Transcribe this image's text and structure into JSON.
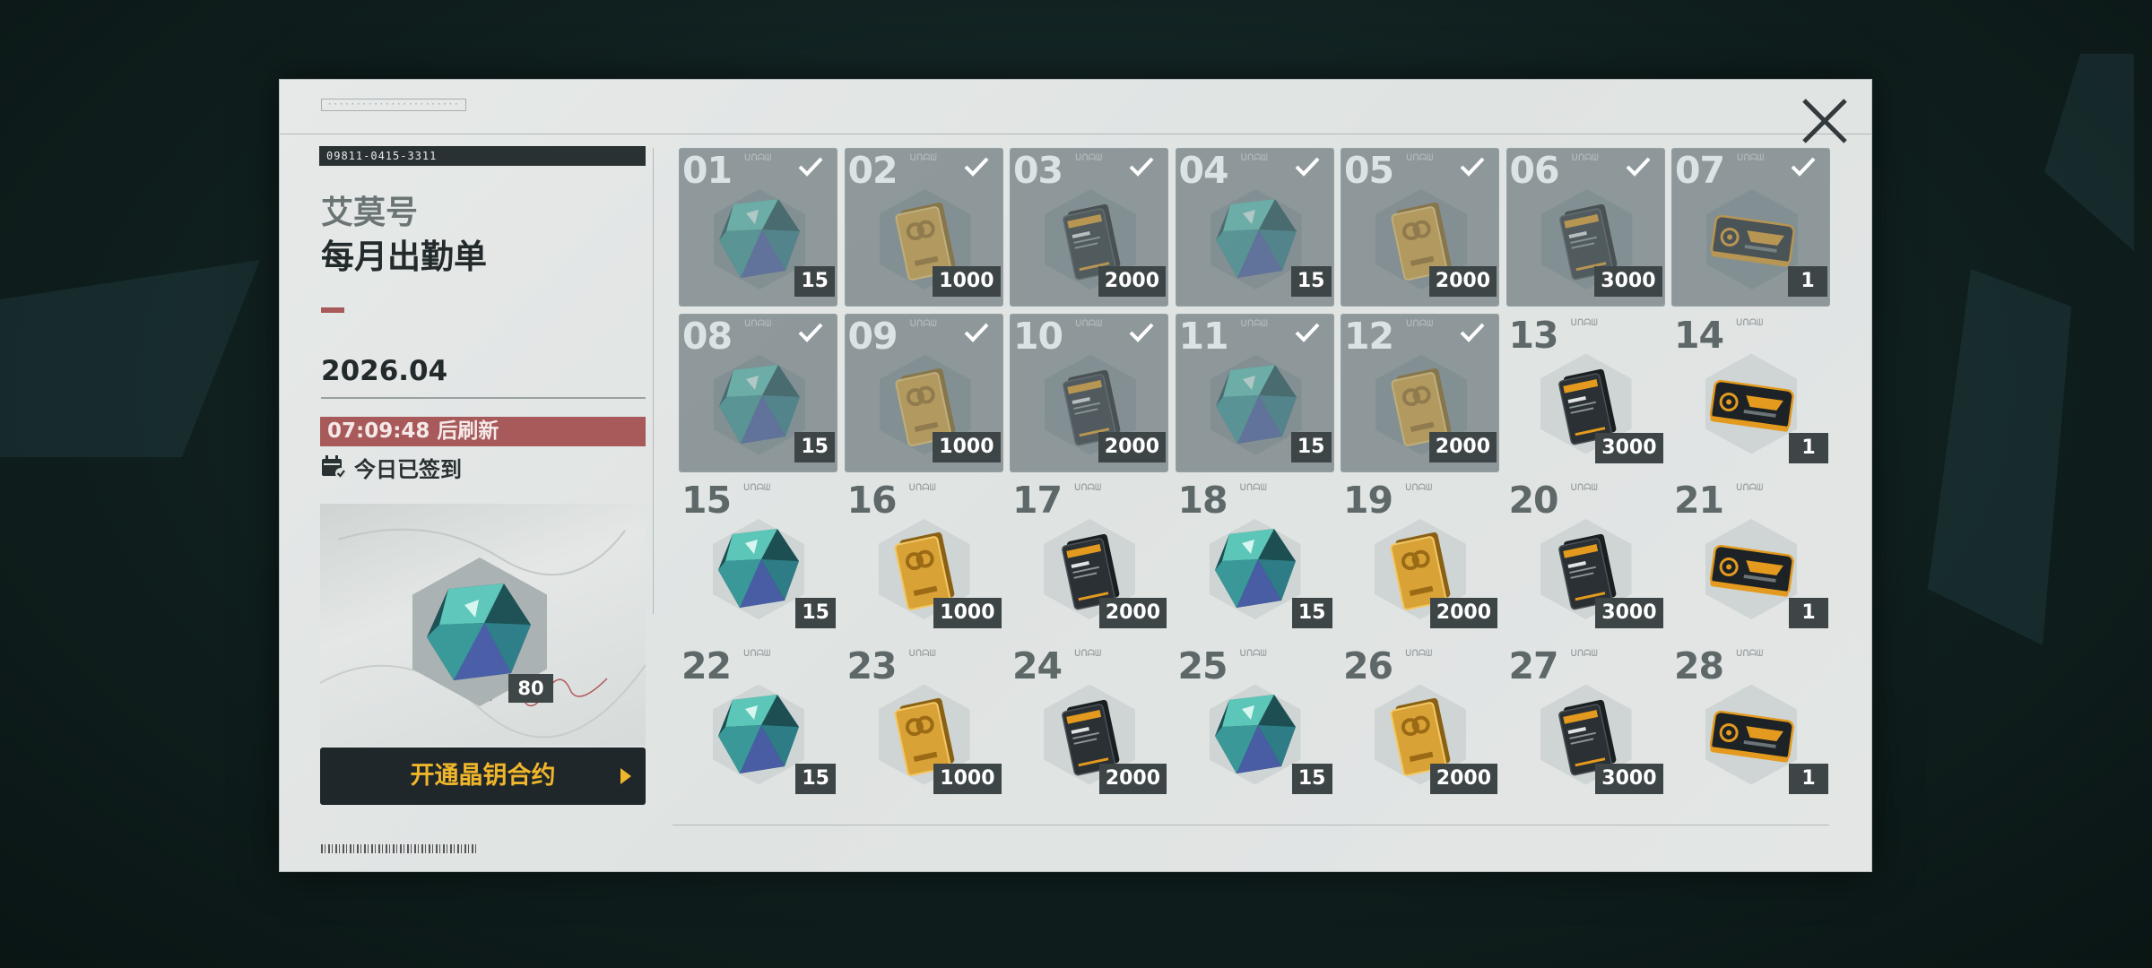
{
  "header": {
    "serial": "09811-0415-3311",
    "ship_name": "艾莫号",
    "title": "每月出勤单",
    "date": "2026.04",
    "refresh_text": "07:09:48 后刷新",
    "checked_in_text": "今日已签到"
  },
  "bonus": {
    "item": "crystal-icon",
    "count": "80"
  },
  "contract_button": {
    "label": "开通晶钥合约"
  },
  "days": [
    {
      "num": "01",
      "item": "crystal",
      "qty": "15",
      "claimed": true
    },
    {
      "num": "02",
      "item": "gold",
      "qty": "1000",
      "claimed": true
    },
    {
      "num": "03",
      "item": "card",
      "qty": "2000",
      "claimed": true
    },
    {
      "num": "04",
      "item": "crystal",
      "qty": "15",
      "claimed": true
    },
    {
      "num": "05",
      "item": "gold",
      "qty": "2000",
      "claimed": true
    },
    {
      "num": "06",
      "item": "card",
      "qty": "3000",
      "claimed": true
    },
    {
      "num": "07",
      "item": "ticket",
      "qty": "1",
      "claimed": true
    },
    {
      "num": "08",
      "item": "crystal",
      "qty": "15",
      "claimed": true
    },
    {
      "num": "09",
      "item": "gold",
      "qty": "1000",
      "claimed": true
    },
    {
      "num": "10",
      "item": "card",
      "qty": "2000",
      "claimed": true
    },
    {
      "num": "11",
      "item": "crystal",
      "qty": "15",
      "claimed": true
    },
    {
      "num": "12",
      "item": "gold",
      "qty": "2000",
      "claimed": true
    },
    {
      "num": "13",
      "item": "card",
      "qty": "3000",
      "claimed": false
    },
    {
      "num": "14",
      "item": "ticket",
      "qty": "1",
      "claimed": false
    },
    {
      "num": "15",
      "item": "crystal",
      "qty": "15",
      "claimed": false
    },
    {
      "num": "16",
      "item": "gold",
      "qty": "1000",
      "claimed": false
    },
    {
      "num": "17",
      "item": "card",
      "qty": "2000",
      "claimed": false
    },
    {
      "num": "18",
      "item": "crystal",
      "qty": "15",
      "claimed": false
    },
    {
      "num": "19",
      "item": "gold",
      "qty": "2000",
      "claimed": false
    },
    {
      "num": "20",
      "item": "card",
      "qty": "3000",
      "claimed": false
    },
    {
      "num": "21",
      "item": "ticket",
      "qty": "1",
      "claimed": false
    },
    {
      "num": "22",
      "item": "crystal",
      "qty": "15",
      "claimed": false
    },
    {
      "num": "23",
      "item": "gold",
      "qty": "1000",
      "claimed": false
    },
    {
      "num": "24",
      "item": "card",
      "qty": "2000",
      "claimed": false
    },
    {
      "num": "25",
      "item": "crystal",
      "qty": "15",
      "claimed": false
    },
    {
      "num": "26",
      "item": "gold",
      "qty": "2000",
      "claimed": false
    },
    {
      "num": "27",
      "item": "card",
      "qty": "3000",
      "claimed": false
    },
    {
      "num": "28",
      "item": "ticket",
      "qty": "1",
      "claimed": false
    }
  ],
  "colors": {
    "accent_red": "#a85a5b",
    "accent_gold": "#f0b62b",
    "claimed_overlay": "#4b5a5e",
    "qty_badge": "#3d4547"
  }
}
